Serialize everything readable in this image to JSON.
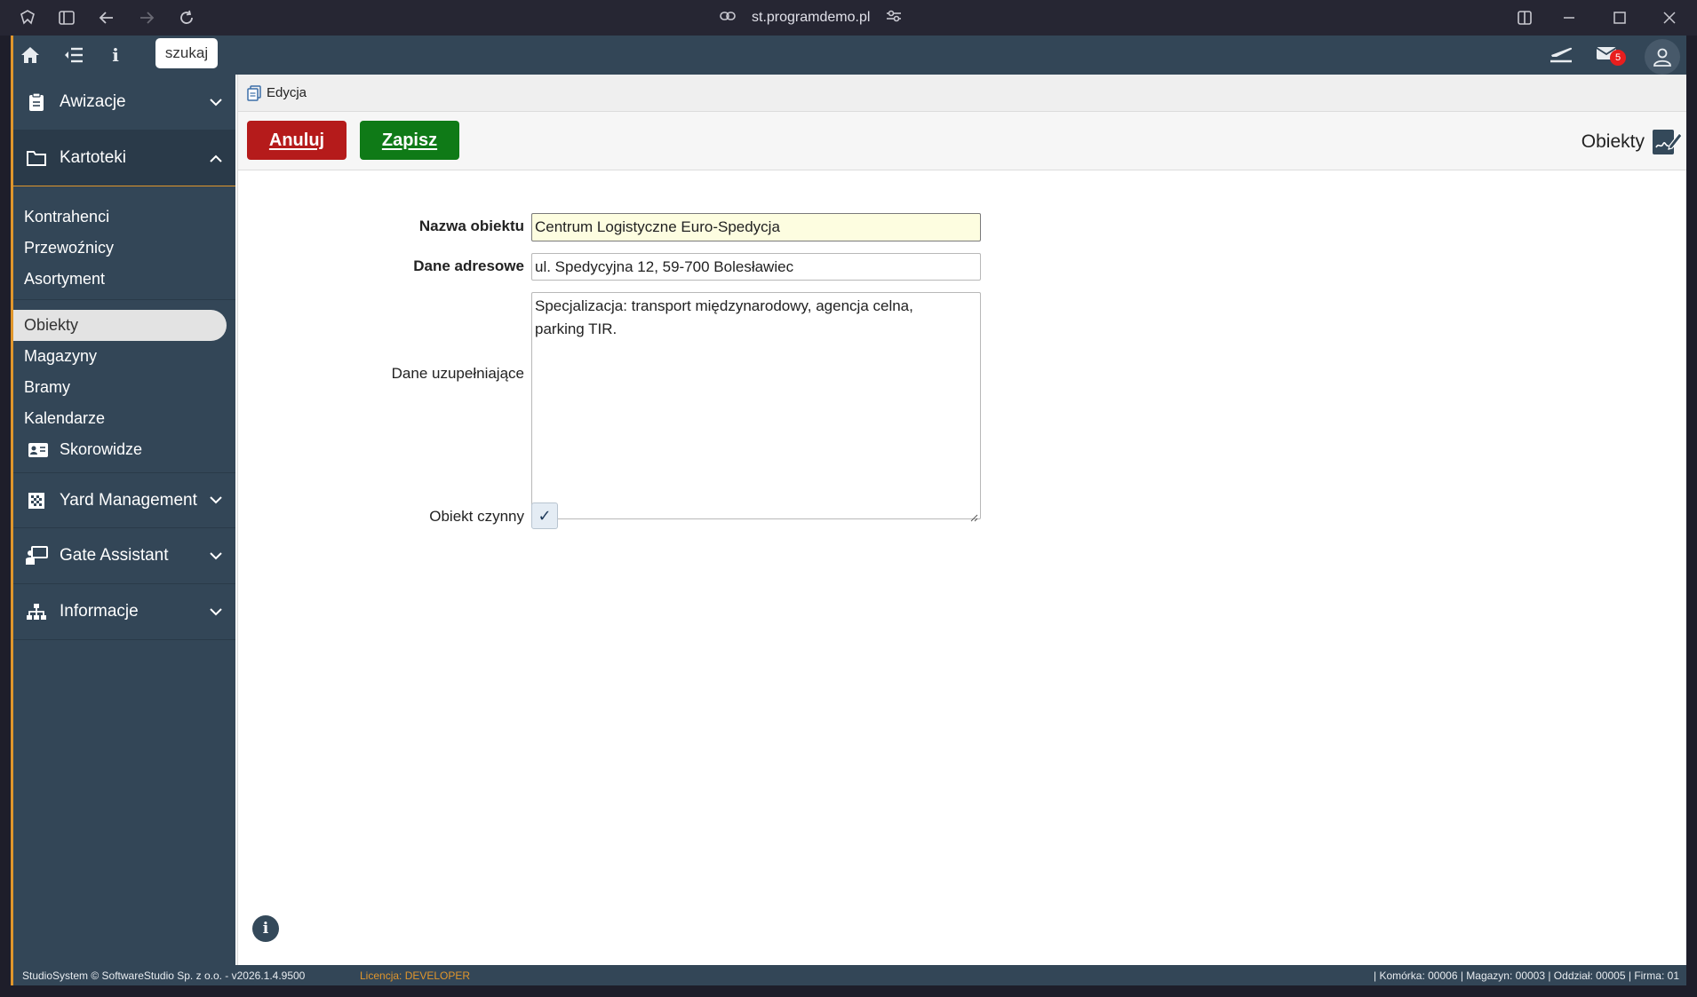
{
  "browser": {
    "url": "st.programdemo.pl"
  },
  "topbar": {
    "search_label": "szukaj",
    "mail_count": "5"
  },
  "sidebar": {
    "sections": {
      "awizacje": "Awizacje",
      "kartoteki": "Kartoteki",
      "yard": "Yard Management",
      "gate": "Gate Assistant",
      "informacje": "Informacje"
    },
    "items": [
      "Kontrahenci",
      "Przewoźnicy",
      "Asortyment",
      "Obiekty",
      "Magazyny",
      "Bramy",
      "Kalendarze",
      "Skorowidze"
    ],
    "active_item": "Obiekty"
  },
  "main": {
    "breadcrumb": "Edycja",
    "cancel_label": "Anuluj",
    "save_label": "Zapisz",
    "page_title": "Obiekty",
    "form": {
      "name_label": "Nazwa obiektu",
      "name_value": "Centrum Logistyczne Euro-Spedycja",
      "address_label": "Dane adresowe",
      "address_value": "ul. Spedycyjna 12, 59-700 Bolesławiec",
      "extra_label": "Dane uzupełniające",
      "extra_value": "Specjalizacja: transport międzynarodowy, agencja celna,\nparking TIR.",
      "active_label": "Obiekt czynny",
      "active_checked": true
    }
  },
  "footer": {
    "copyright": "StudioSystem © SoftwareStudio Sp. z o.o. - v2026.1.4.9500",
    "license": "Licencja: DEVELOPER",
    "status": "| Komórka: 00006 | Magazyn: 00003 | Oddział: 00005 | Firma: 01"
  },
  "colors": {
    "sidebar": "#334657",
    "accent": "#e0962c",
    "cancel": "#b51b1b",
    "save": "#0f7a17"
  }
}
